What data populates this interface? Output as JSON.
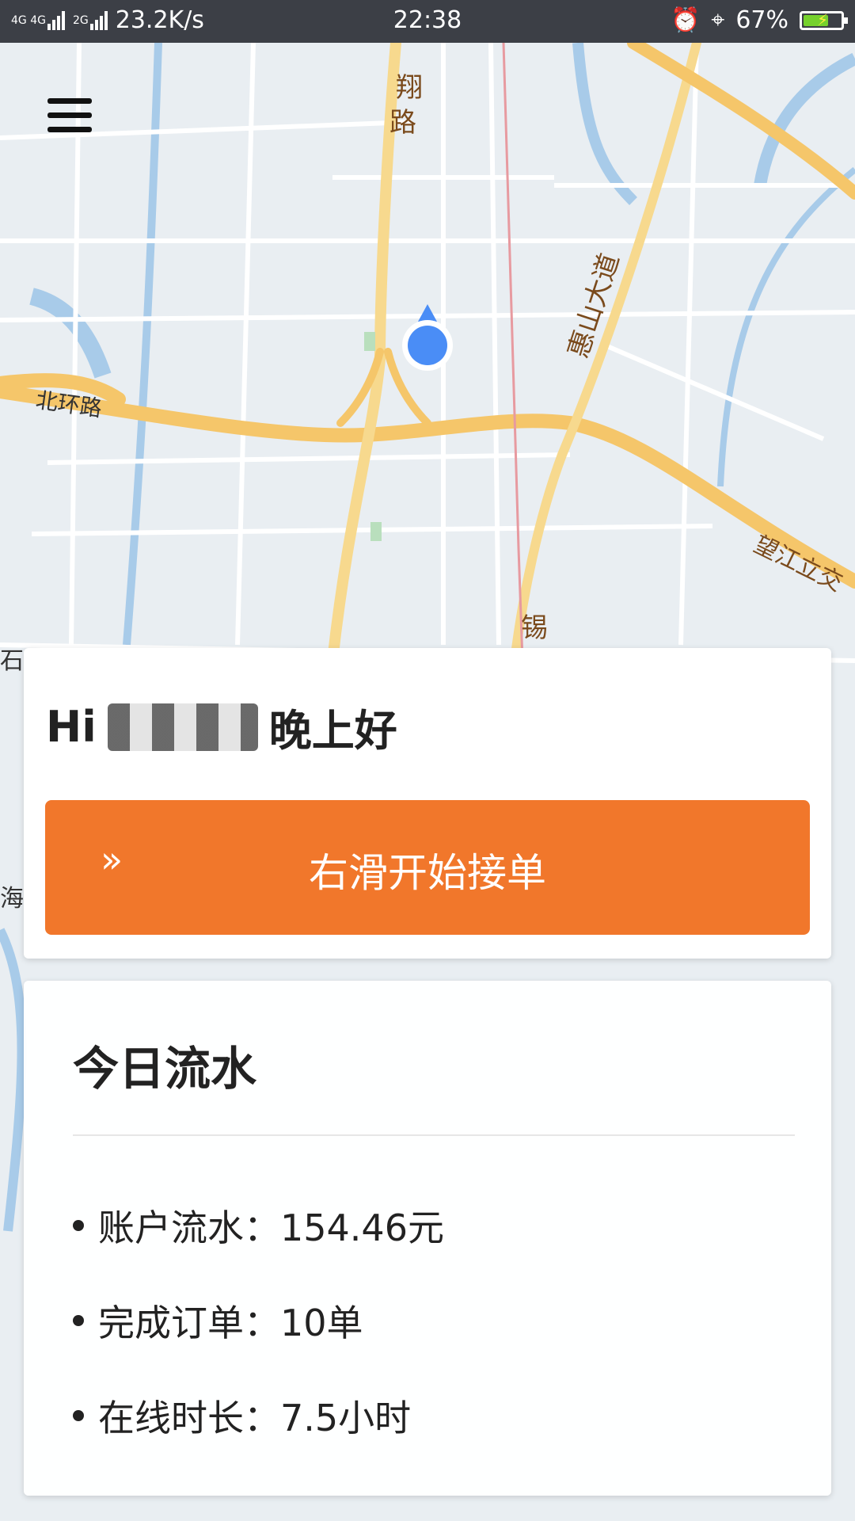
{
  "status_bar": {
    "net1": "4G 4G",
    "net2": "2G",
    "speed": "23.2K/s",
    "time": "22:38",
    "battery_percent": "67%",
    "battery_level": 0.67,
    "icons": [
      "alarm-icon",
      "location-icon",
      "battery-icon"
    ]
  },
  "map": {
    "labels": {
      "bei_huan_lu": "北环路",
      "xiang_lu_1": "翔",
      "xiang_lu_2": "路",
      "huishan_dadao": "惠山大道",
      "wangjiang": "望江立交",
      "xi": "锡",
      "shi": "石",
      "hai": "海西"
    },
    "accent": "#4a8df6"
  },
  "header": {
    "menu_icon": "hamburger-icon"
  },
  "greeting": {
    "hi": "Hi",
    "salutation": "晚上好"
  },
  "slider": {
    "chevrons": "»",
    "label": "右滑开始接单",
    "color": "#f1772b"
  },
  "stats": {
    "title": "今日流水",
    "rows": [
      {
        "label": "账户流水：",
        "value": "154.46元"
      },
      {
        "label": "完成订单：",
        "value": "10单"
      },
      {
        "label": "在线时长：",
        "value": "7.5小时"
      }
    ]
  }
}
